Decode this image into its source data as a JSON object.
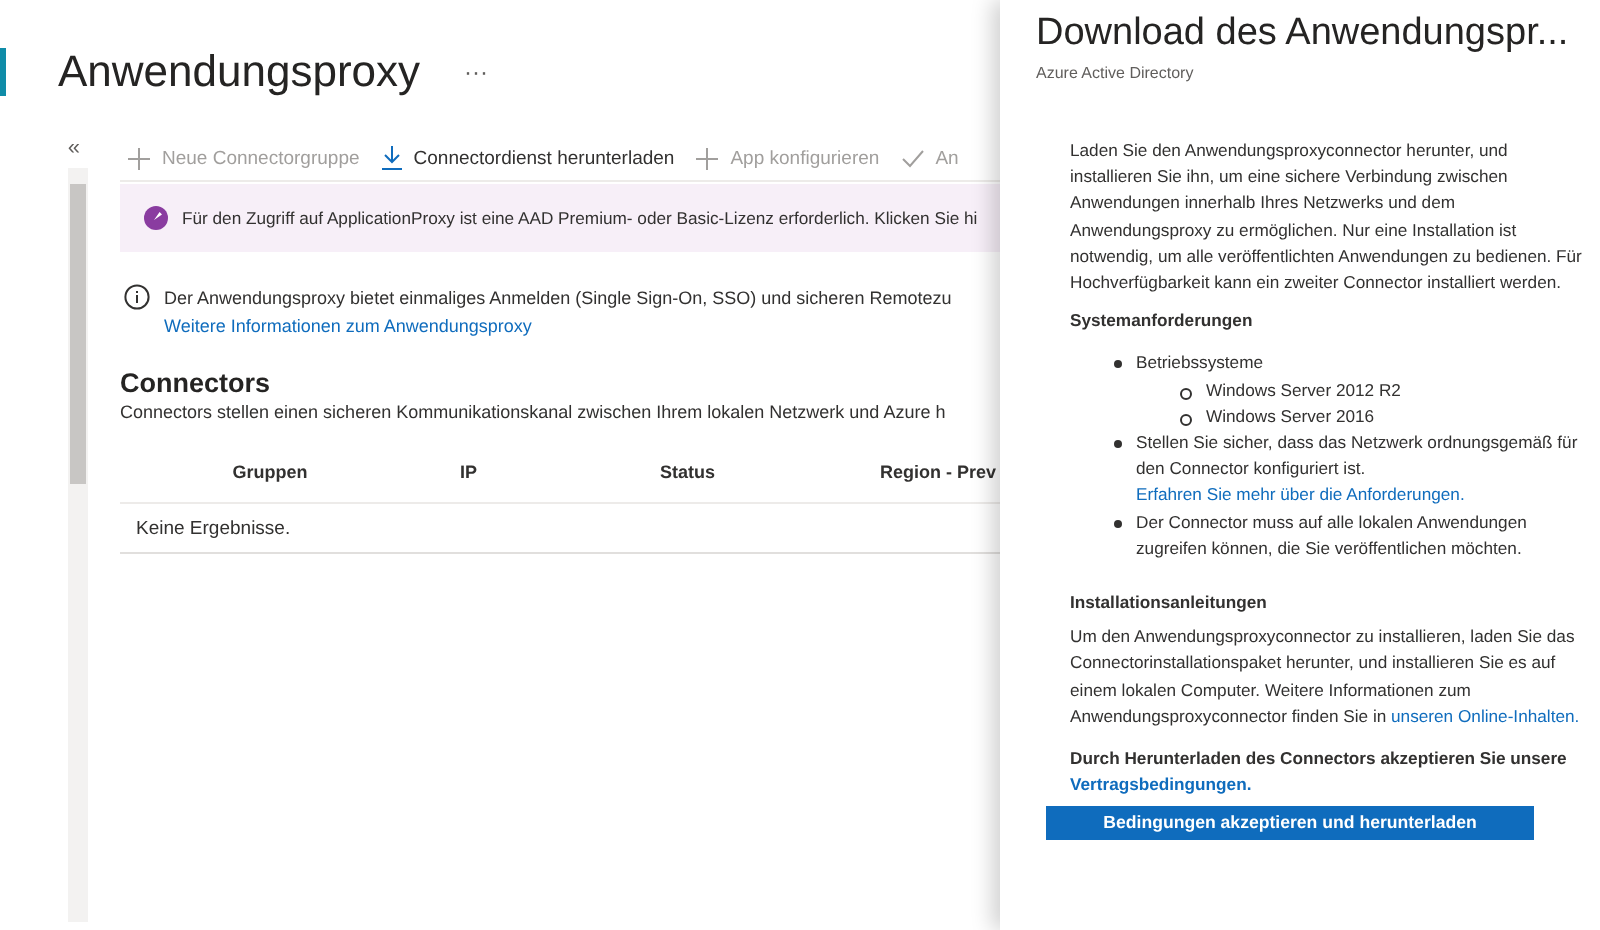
{
  "page": {
    "title": "Anwendungsproxy",
    "more_label": "···",
    "collapse_label": "«"
  },
  "toolbar": [
    {
      "kind": "add",
      "label": "Neue Connectorgruppe",
      "disabled": true
    },
    {
      "kind": "download",
      "label": "Connectordienst herunterladen",
      "disabled": false
    },
    {
      "kind": "add",
      "label": "App konfigurieren",
      "disabled": true
    },
    {
      "kind": "check",
      "label": "An",
      "disabled": true
    }
  ],
  "banner": {
    "text": "Für den Zugriff auf ApplicationProxy ist eine AAD Premium- oder Basic-Lizenz erforderlich. Klicken Sie hi"
  },
  "info": {
    "text": "Der Anwendungsproxy bietet einmaliges Anmelden (Single Sign-On, SSO) und sicheren Remotezu",
    "link": "Weitere Informationen zum Anwendungsproxy"
  },
  "connectors": {
    "heading": "Connectors",
    "description": "Connectors stellen einen sicheren Kommunikationskanal zwischen Ihrem lokalen Netzwerk und Azure h",
    "columns": [
      "Gruppen",
      "IP",
      "Status",
      "Region - Prev"
    ],
    "empty_text": "Keine Ergebnisse."
  },
  "panel": {
    "title": "Download des Anwendungspr...",
    "subtitle": "Azure Active Directory",
    "intro": "Laden Sie den Anwendungsproxyconnector herunter, und installieren Sie ihn, um eine sichere Verbindung zwischen Anwendungen innerhalb Ihres Netzwerks und dem Anwendungsproxy zu ermöglichen. Nur eine Installation ist notwendig, um alle veröffentlichten Anwendungen zu bedienen. Für Hochverfügbarkeit kann ein zweiter Connector installiert werden.",
    "requirements": {
      "heading": "Systemanforderungen",
      "items": [
        {
          "text": "Betriebssysteme",
          "children": [
            {
              "text": "Windows Server 2012 R2"
            },
            {
              "text": "Windows Server 2016"
            }
          ]
        },
        {
          "text": "Stellen Sie sicher, dass das Netzwerk ordnungsgemäß für den Connector konfiguriert ist.",
          "link": "Erfahren Sie mehr über die Anforderungen."
        },
        {
          "text": "Der Connector muss auf alle lokalen Anwendungen zugreifen können, die Sie veröffentlichen möchten."
        }
      ]
    },
    "install": {
      "heading": "Installationsanleitungen",
      "text": "Um den Anwendungsproxyconnector zu installieren, laden Sie das Connectorinstallationspaket herunter, und installieren Sie es auf einem lokalen Computer. Weitere Informationen zum Anwendungsproxyconnector finden Sie in",
      "link": "unseren Online-Inhalten."
    },
    "terms": {
      "text": "Durch Herunterladen des Connectors akzeptieren Sie unsere",
      "link": "Vertragsbedingungen."
    },
    "button": "Bedingungen akzeptieren und herunterladen"
  }
}
